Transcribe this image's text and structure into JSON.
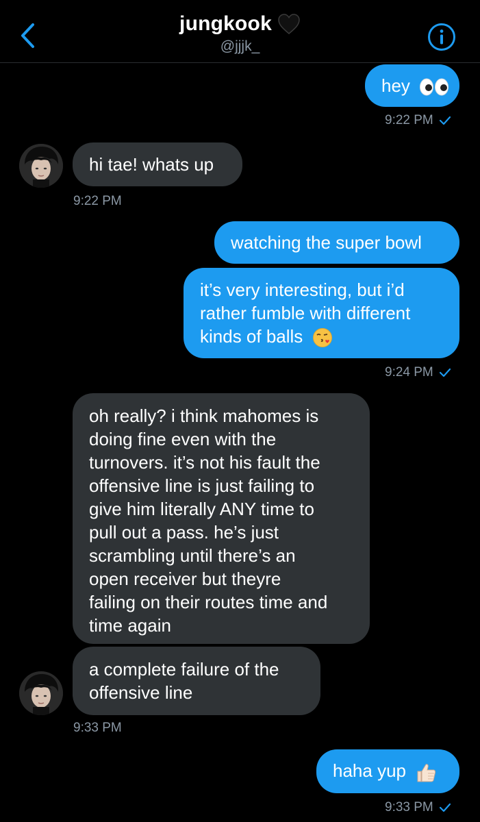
{
  "header": {
    "title": "jungkook",
    "title_emoji": "black-heart-icon",
    "handle": "@jjjk_"
  },
  "colors": {
    "background": "#000000",
    "outgoing_bubble": "#1d9bf0",
    "incoming_bubble": "#2f3336",
    "accent": "#1d9bf0",
    "muted_text": "#8b98a5"
  },
  "messages": [
    {
      "direction": "out",
      "lines": [
        "hey"
      ],
      "emoji": "eyes-icon",
      "time": "9:22 PM",
      "read": true
    },
    {
      "direction": "in",
      "lines": [
        "hi tae! whats up"
      ],
      "time": "9:22 PM"
    },
    {
      "direction": "out",
      "lines": [
        "watching the super bowl"
      ]
    },
    {
      "direction": "out",
      "lines": [
        "it’s very interesting, but i’d",
        "rather fumble with different",
        "kinds of balls"
      ],
      "emoji": "face-blowing-kiss-icon",
      "time": "9:24 PM",
      "read": true
    },
    {
      "direction": "in",
      "lines": [
        "oh really? i think mahomes is",
        "doing fine even with the",
        "turnovers. it’s not his fault the",
        "offensive line is just failing to",
        "give him literally ANY time to",
        "pull out a pass. he’s just",
        "scrambling until there’s an",
        "open receiver but theyre",
        "failing on their routes time and",
        "time again"
      ]
    },
    {
      "direction": "in",
      "lines": [
        "a complete failure of the",
        "offensive line"
      ],
      "time": "9:33 PM"
    },
    {
      "direction": "out",
      "lines": [
        "haha yup"
      ],
      "emoji": "thumbs-up-icon",
      "time": "9:33 PM",
      "read": true
    }
  ]
}
